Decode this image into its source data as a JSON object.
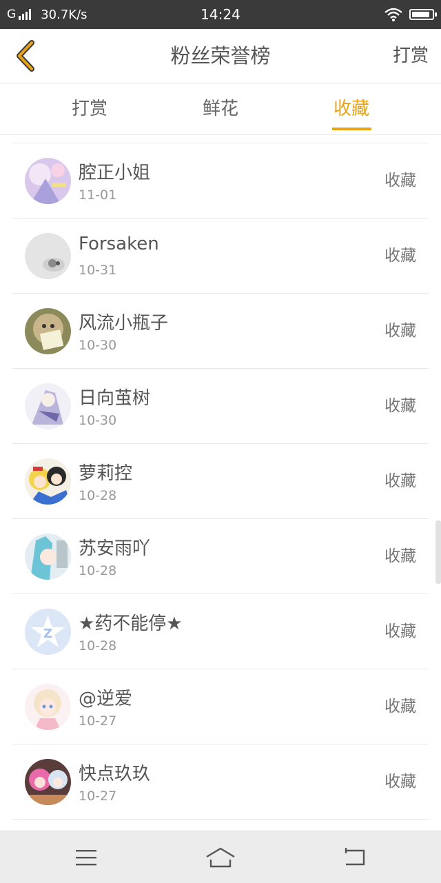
{
  "status_bar": {
    "network_type": "G",
    "speed": "30.7K/s",
    "time": "14:24",
    "battery_level": 0.9
  },
  "header": {
    "title": "粉丝荣誉榜",
    "action_label": "打赏",
    "accent_color": "#e8a317"
  },
  "tabs": [
    {
      "label": "打赏",
      "active": false
    },
    {
      "label": "鲜花",
      "active": false
    },
    {
      "label": "收藏",
      "active": true
    }
  ],
  "fans": [
    {
      "name": "腔正小姐",
      "date": "11-01",
      "type": "收藏"
    },
    {
      "name": "Forsaken",
      "date": "10-31",
      "type": "收藏"
    },
    {
      "name": "风流小瓶子",
      "date": "10-30",
      "type": "收藏"
    },
    {
      "name": "日向茧树",
      "date": "10-30",
      "type": "收藏"
    },
    {
      "name": "萝莉控",
      "date": "10-28",
      "type": "收藏"
    },
    {
      "name": "苏安雨吖",
      "date": "10-28",
      "type": "收藏"
    },
    {
      "name": "★药不能停★",
      "date": "10-28",
      "type": "收藏"
    },
    {
      "name": "@逆爱",
      "date": "10-27",
      "type": "收藏"
    },
    {
      "name": "快点玖玖",
      "date": "10-27",
      "type": "收藏"
    }
  ],
  "bottom_nav": {
    "items": [
      "menu-icon",
      "home-icon",
      "back-icon"
    ]
  }
}
